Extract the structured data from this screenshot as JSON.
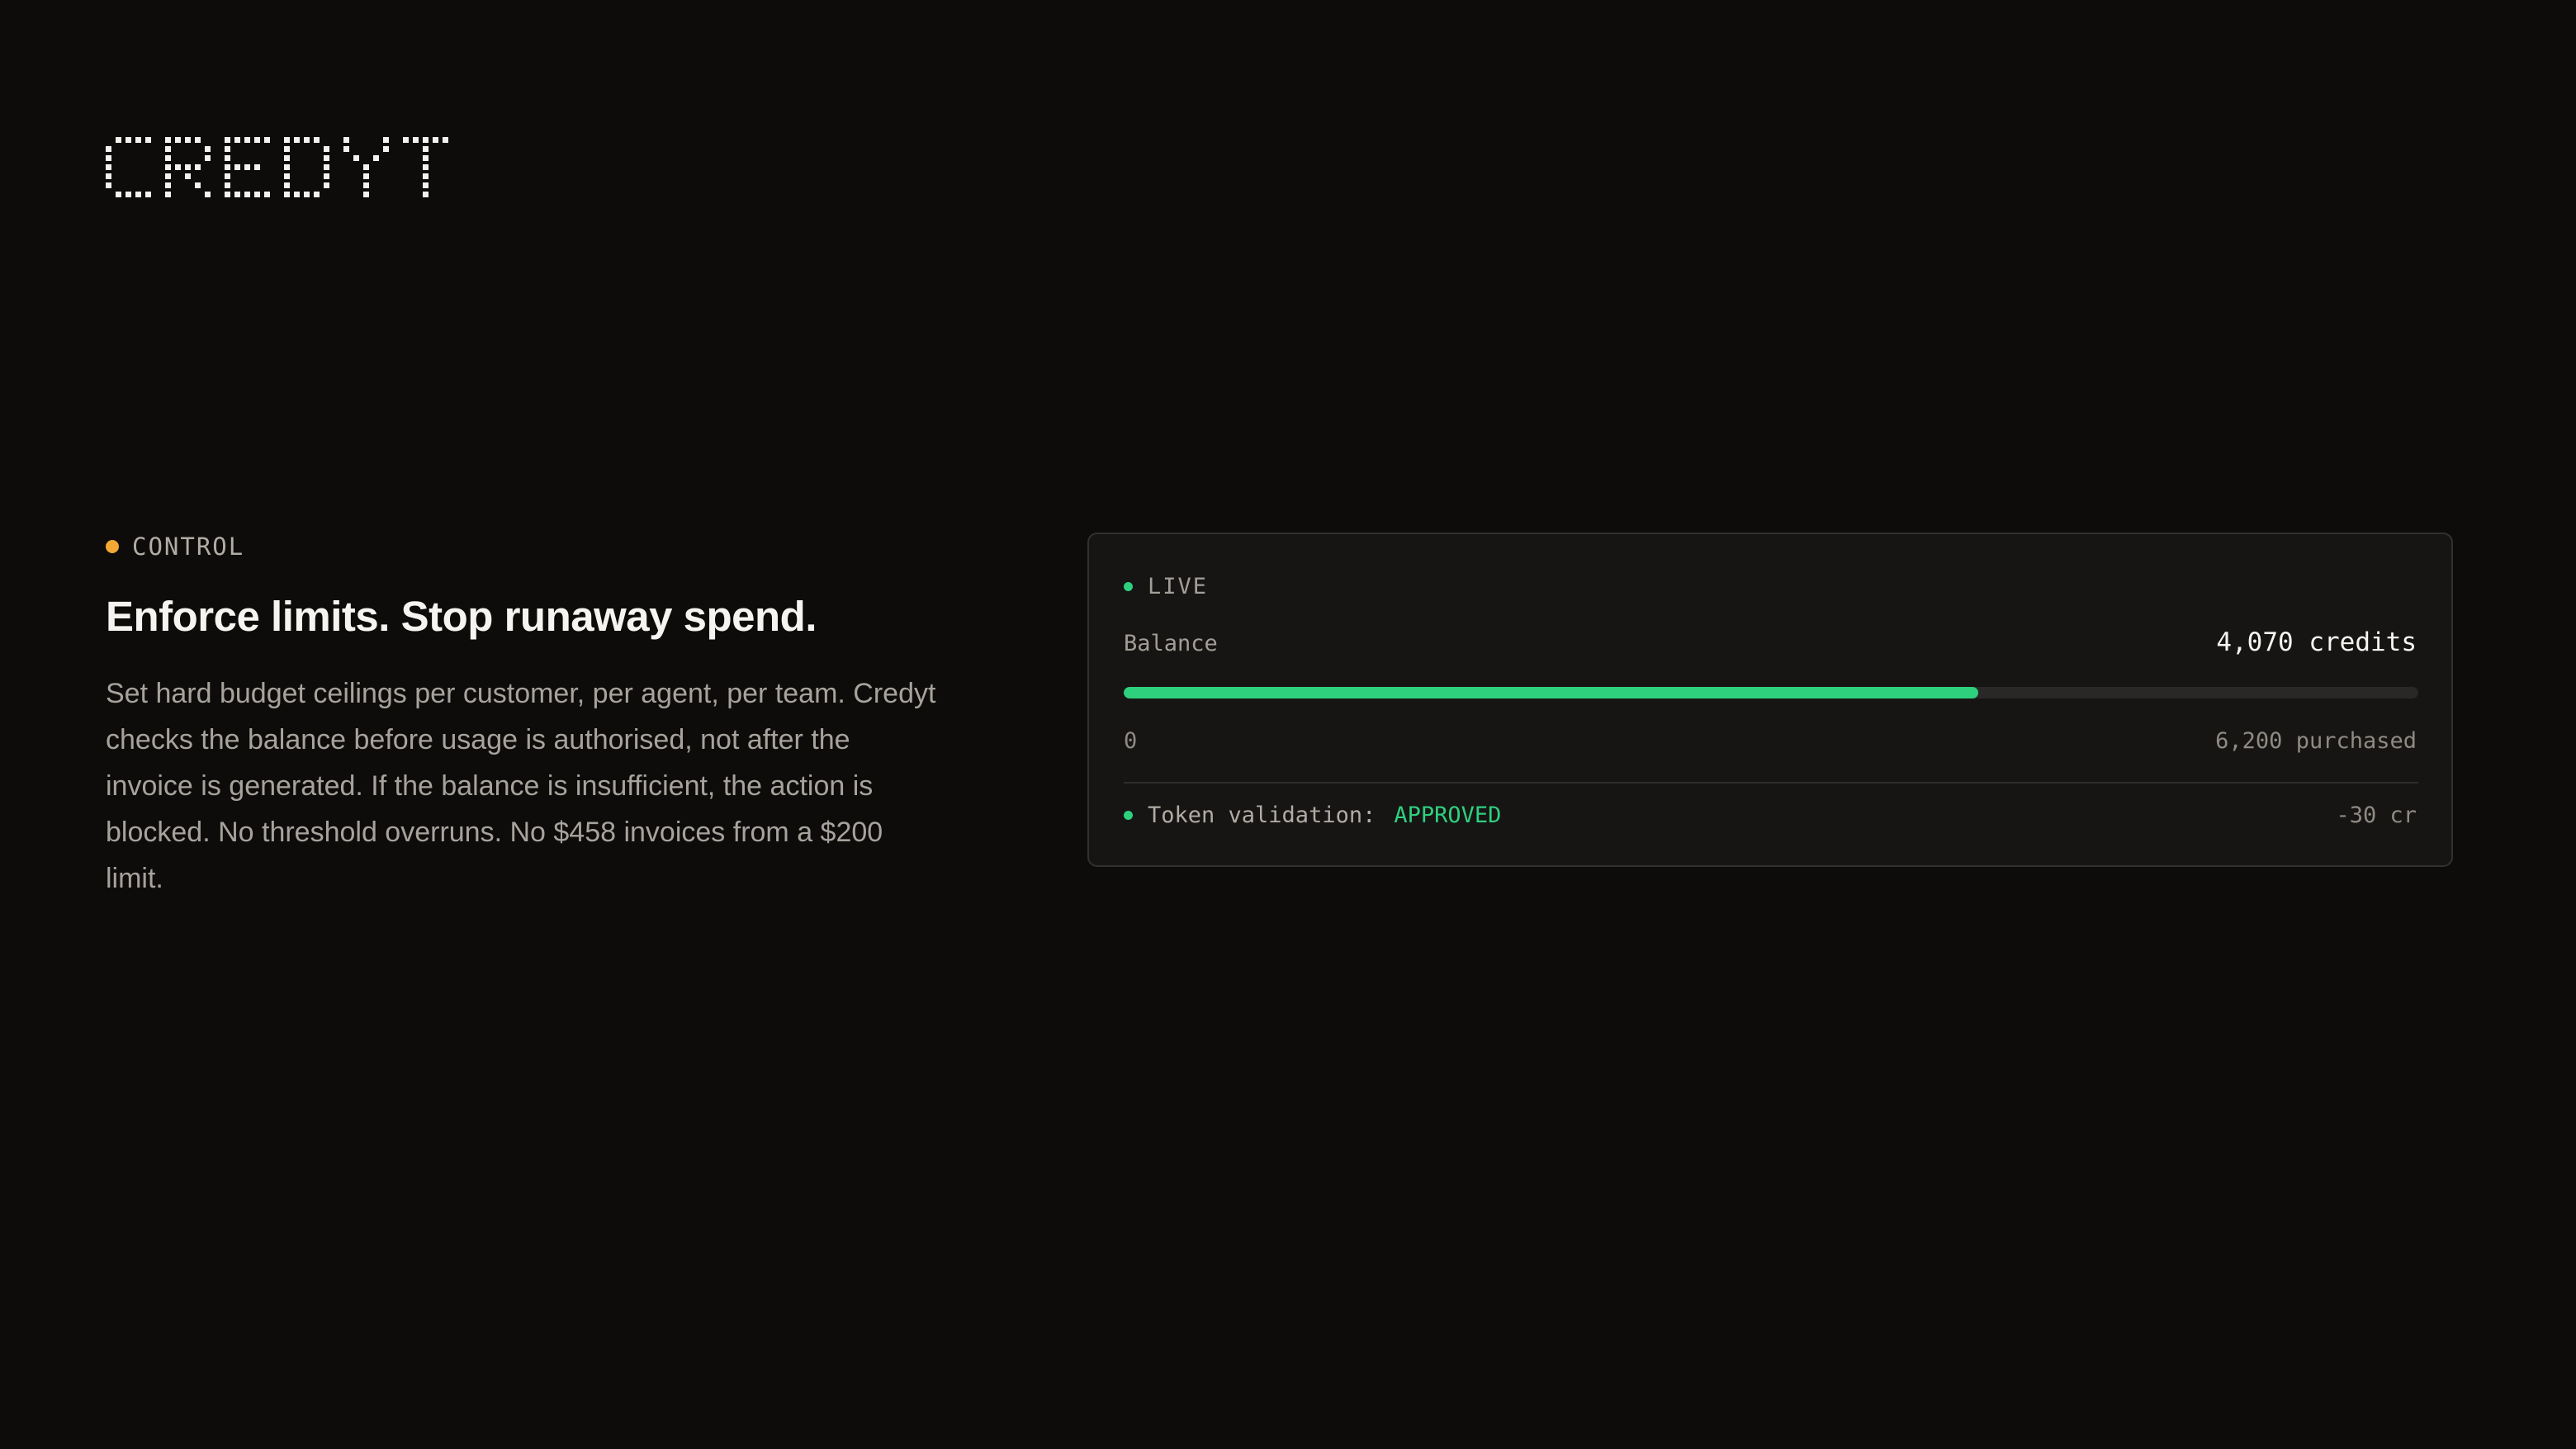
{
  "brand": {
    "name": "CREDYT"
  },
  "section": {
    "eyebrow": "CONTROL",
    "headline": "Enforce limits. Stop runaway spend.",
    "body": "Set hard budget ceilings per customer, per agent, per team. Credyt checks the balance before usage is authorised, not after the invoice is generated. If the balance is insufficient, the action is blocked. No threshold overruns. No $458 invoices from a $200 limit."
  },
  "card": {
    "status": "LIVE",
    "balance_label": "Balance",
    "balance_value": "4,070 credits",
    "range_min": "0",
    "range_max": "6,200 purchased",
    "progress_fraction": 0.66,
    "token_label": "Token validation:",
    "token_status": "APPROVED",
    "token_cost": "-30 cr"
  },
  "colors": {
    "background": "#0d0c0b",
    "accent_green": "#2ed07e",
    "accent_amber": "#f3a833",
    "card_background": "#161514"
  }
}
